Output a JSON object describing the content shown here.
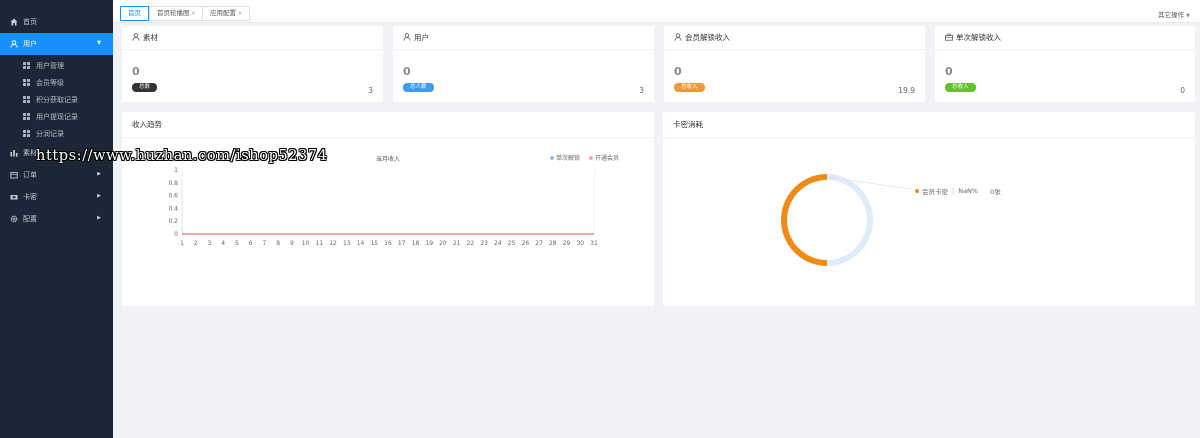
{
  "sidebar": {
    "home": {
      "label": "首页",
      "icon": "home-icon"
    },
    "user": {
      "label": "用户",
      "icon": "user-icon"
    },
    "user_subitems": [
      {
        "label": "用户管理"
      },
      {
        "label": "会员等级"
      },
      {
        "label": "积分获取记录"
      },
      {
        "label": "用户提现记录"
      },
      {
        "label": "分润记录"
      }
    ],
    "material": {
      "label": "素材",
      "icon": "bar-chart-icon"
    },
    "order": {
      "label": "订单",
      "icon": "order-icon"
    },
    "card": {
      "label": "卡密",
      "icon": "card-icon"
    },
    "config": {
      "label": "配置",
      "icon": "gear-icon"
    }
  },
  "topbar": {
    "tabs": [
      {
        "label": "首页"
      },
      {
        "label": "首页轮播图"
      },
      {
        "label": "应用配置"
      }
    ],
    "other_ops": "其它操作"
  },
  "stats": [
    {
      "title": "素材",
      "icon": "user-icon",
      "value": "0",
      "badge": "总数",
      "badge_color": "#333333",
      "total": "3"
    },
    {
      "title": "用户",
      "icon": "user-icon",
      "value": "0",
      "badge": "总人数",
      "badge_color": "#3d9af5",
      "total": "3"
    },
    {
      "title": "会员解锁收入",
      "icon": "user-icon",
      "value": "0",
      "badge": "总收入",
      "badge_color": "#ec9a3c",
      "total": "19.9"
    },
    {
      "title": "单次解锁收入",
      "icon": "briefcase-icon",
      "value": "0",
      "badge": "总收入",
      "badge_color": "#62c22f",
      "total": "0"
    }
  ],
  "income_panel": {
    "title": "收入趋势"
  },
  "card_panel": {
    "title": "卡密消耗"
  },
  "chart_data": [
    {
      "type": "line",
      "title": "当月收入",
      "categories": [
        "1",
        "2",
        "3",
        "4",
        "5",
        "6",
        "7",
        "8",
        "9",
        "10",
        "11",
        "12",
        "13",
        "14",
        "15",
        "16",
        "17",
        "18",
        "19",
        "20",
        "21",
        "22",
        "23",
        "24",
        "25",
        "26",
        "27",
        "28",
        "29",
        "30",
        "31"
      ],
      "yticks": [
        "0",
        "0.2",
        "0.4",
        "0.6",
        "0.8",
        "1"
      ],
      "ylim": [
        0,
        1
      ],
      "series": [
        {
          "name": "单次解锁",
          "color": "#91a3e6",
          "values": [
            0,
            0,
            0,
            0,
            0,
            0,
            0,
            0,
            0,
            0,
            0,
            0,
            0,
            0,
            0,
            0,
            0,
            0,
            0,
            0,
            0,
            0,
            0,
            0,
            0,
            0,
            0,
            0,
            0,
            0,
            0
          ]
        },
        {
          "name": "开通会员",
          "color": "#f3998f",
          "values": [
            0,
            0,
            0,
            0,
            0,
            0,
            0,
            0,
            0,
            0,
            0,
            0,
            0,
            0,
            0,
            0,
            0,
            0,
            0,
            0,
            0,
            0,
            0,
            0,
            0,
            0,
            0,
            0,
            0,
            0,
            0
          ]
        }
      ],
      "legend": "top-right"
    },
    {
      "type": "pie",
      "slices": [
        {
          "name": "会员卡密",
          "percent_text": "NaN%",
          "count_text": "0张",
          "color": "#f28a16"
        }
      ]
    }
  ],
  "watermark": "https://www.huzhan.com/ishop52374"
}
